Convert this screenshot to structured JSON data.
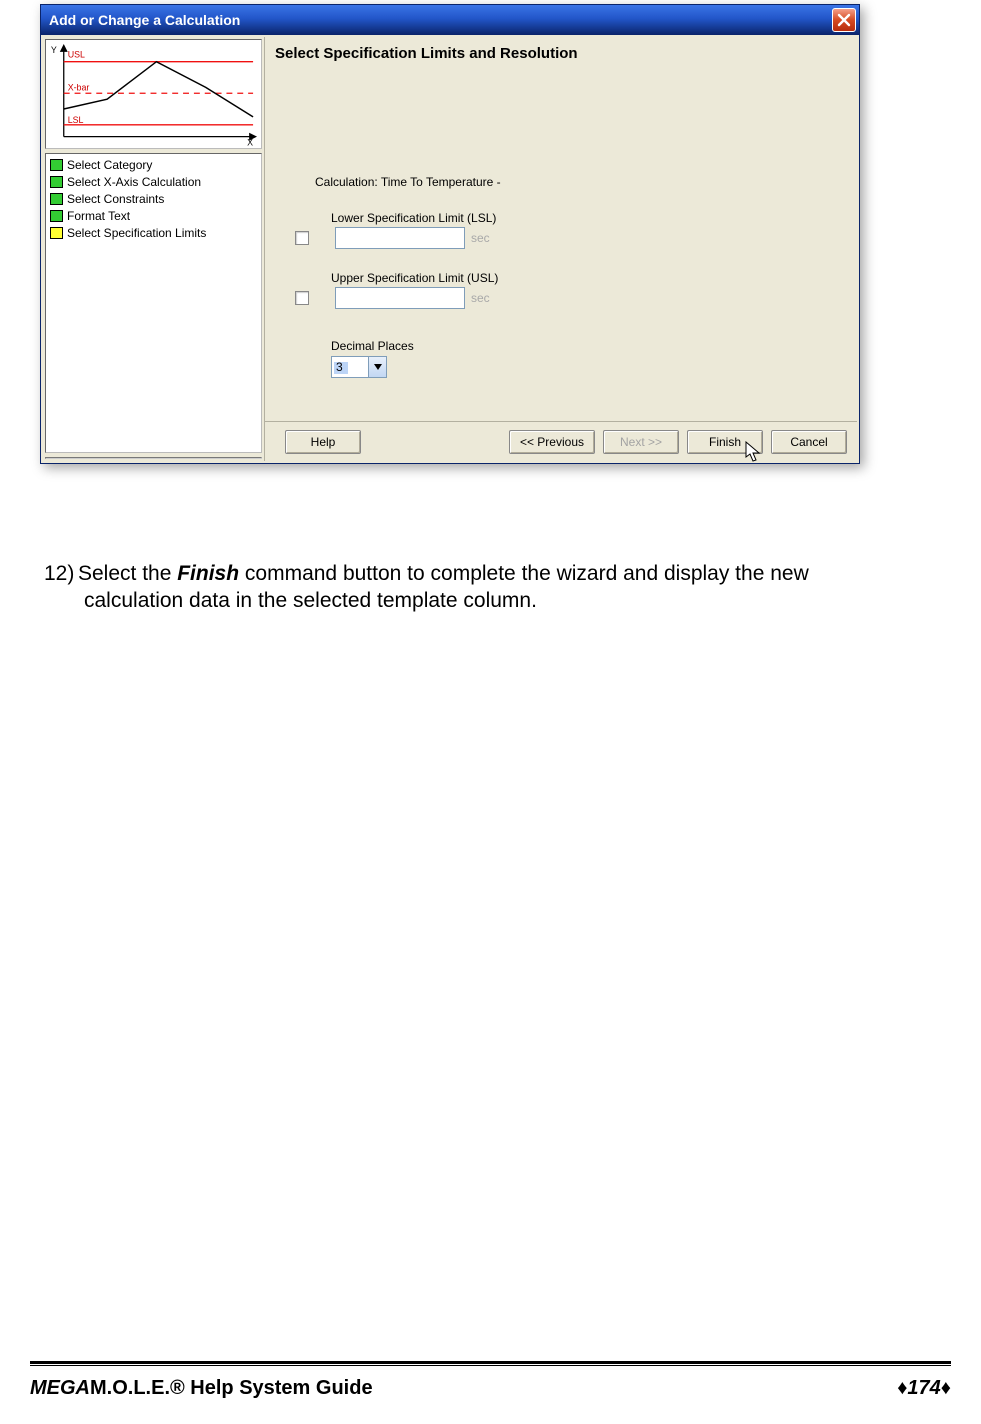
{
  "dialog": {
    "title": "Add or Change a Calculation"
  },
  "heading": "Select Specification Limits and Resolution",
  "chart_labels": {
    "y": "Y",
    "usl": "USL",
    "xbar": "X-bar",
    "lsl": "LSL",
    "x": "X"
  },
  "steps": [
    {
      "color": "#33cc33",
      "label": "Select Category"
    },
    {
      "color": "#33cc33",
      "label": "Select X-Axis Calculation"
    },
    {
      "color": "#33cc33",
      "label": "Select Constraints"
    },
    {
      "color": "#33cc33",
      "label": "Format Text"
    },
    {
      "color": "#ffff33",
      "label": "Select Specification Limits"
    }
  ],
  "form": {
    "calculation_label": "Calculation:",
    "calculation_value": "Time To Temperature -",
    "lsl_label": "Lower Specification Limit (LSL)",
    "lsl_unit": "sec",
    "usl_label": "Upper Specification Limit (USL)",
    "usl_unit": "sec",
    "decimal_label": "Decimal Places",
    "decimal_value": "3"
  },
  "buttons": {
    "help": "Help",
    "previous": "<< Previous",
    "next": "Next >>",
    "finish": "Finish",
    "cancel": "Cancel"
  },
  "instruction": {
    "number": "12)",
    "text_pre": "Select the ",
    "bold": "Finish",
    "text_post": " command button to complete the wizard and display the new",
    "line2": "calculation data in the selected template column."
  },
  "footer": {
    "left_italic": "MEGA",
    "left_rest": "M.O.L.E.® Help System Guide",
    "page": "174"
  }
}
